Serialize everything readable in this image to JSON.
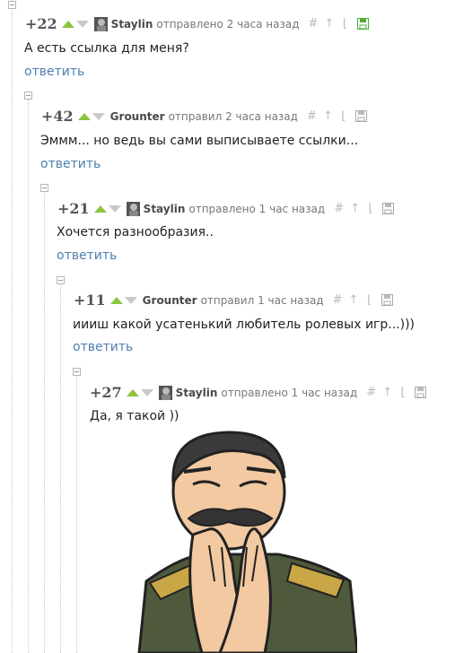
{
  "comments": [
    {
      "rating": "+22",
      "author": "Staylin",
      "time": "отправлено 2 часа назад",
      "text": "А есть ссылка для меня?",
      "reply": "ответить",
      "saved": true
    },
    {
      "rating": "+42",
      "author": "Grounter",
      "time": "отправил 2 часа назад",
      "text": "Эммм... но ведь вы сами выписываете ссылки...",
      "reply": "ответить",
      "saved": false
    },
    {
      "rating": "+21",
      "author": "Staylin",
      "time": "отправлено 1 час назад",
      "text": "Хочется разнообразия..",
      "reply": "ответить",
      "saved": false
    },
    {
      "rating": "+11",
      "author": "Grounter",
      "time": "отправил 1 час назад",
      "text": "иииш какой усатенький любитель ролевых игр...)))",
      "reply": "ответить",
      "saved": false
    },
    {
      "rating": "+27",
      "author": "Staylin",
      "time": "отправлено 1 час назад",
      "text": "Да, я такой ))",
      "reply": "",
      "saved": false
    }
  ],
  "icons": {
    "up": "upvote-arrow-icon",
    "down": "downvote-arrow-icon",
    "link": "hash-icon",
    "parent": "up-arrow-icon",
    "tree": "branch-icon",
    "save": "floppy-disk-icon"
  },
  "colors": {
    "upvote": "#8cc63e",
    "link": "#4d7faf",
    "save_active": "#4cae35"
  }
}
